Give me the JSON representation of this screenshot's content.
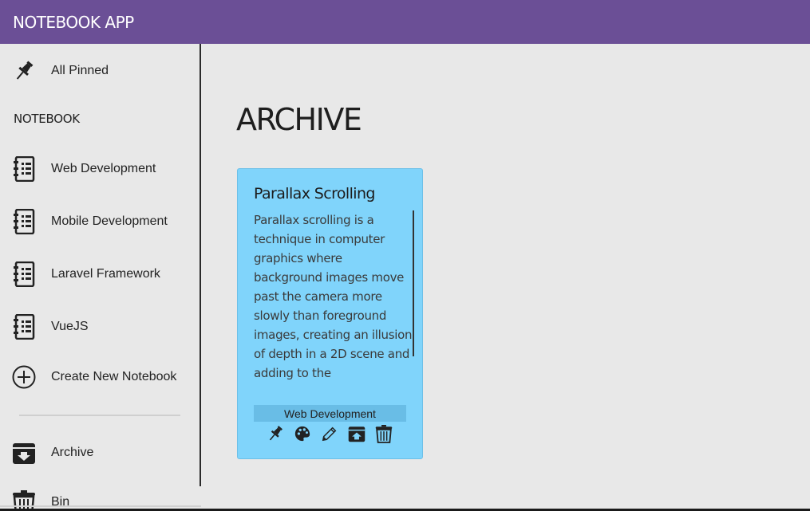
{
  "app": {
    "title": "NOTEBOOK APP"
  },
  "colors": {
    "header": "#6b4f96",
    "card": "#80d4fb",
    "card_tag": "#69bde6",
    "background": "#e8e8e8"
  },
  "sidebar": {
    "pinned": {
      "label": "All Pinned",
      "icon": "pin-icon"
    },
    "section_label": "NOTEBOOK",
    "notebooks": [
      {
        "label": "Web Development",
        "icon": "notebook-icon"
      },
      {
        "label": "Mobile Development",
        "icon": "notebook-icon"
      },
      {
        "label": "Laravel Framework",
        "icon": "notebook-icon"
      },
      {
        "label": "VueJS",
        "icon": "notebook-icon"
      }
    ],
    "create": {
      "label": "Create New Notebook",
      "icon": "plus-circle-icon"
    },
    "archive": {
      "label": "Archive",
      "icon": "archive-icon"
    },
    "bin": {
      "label": "Bin",
      "icon": "trash-icon"
    }
  },
  "main": {
    "title": "ARCHIVE",
    "notes": [
      {
        "title": "Parallax Scrolling",
        "body": "Parallax scrolling is a technique in computer graphics where background images move past the camera more slowly than foreground images, creating an illusion of depth in a 2D scene and adding to the",
        "notebook": "Web Development",
        "actions": [
          "pin-icon",
          "palette-icon",
          "pencil-icon",
          "unarchive-icon",
          "trash-icon"
        ]
      }
    ]
  }
}
